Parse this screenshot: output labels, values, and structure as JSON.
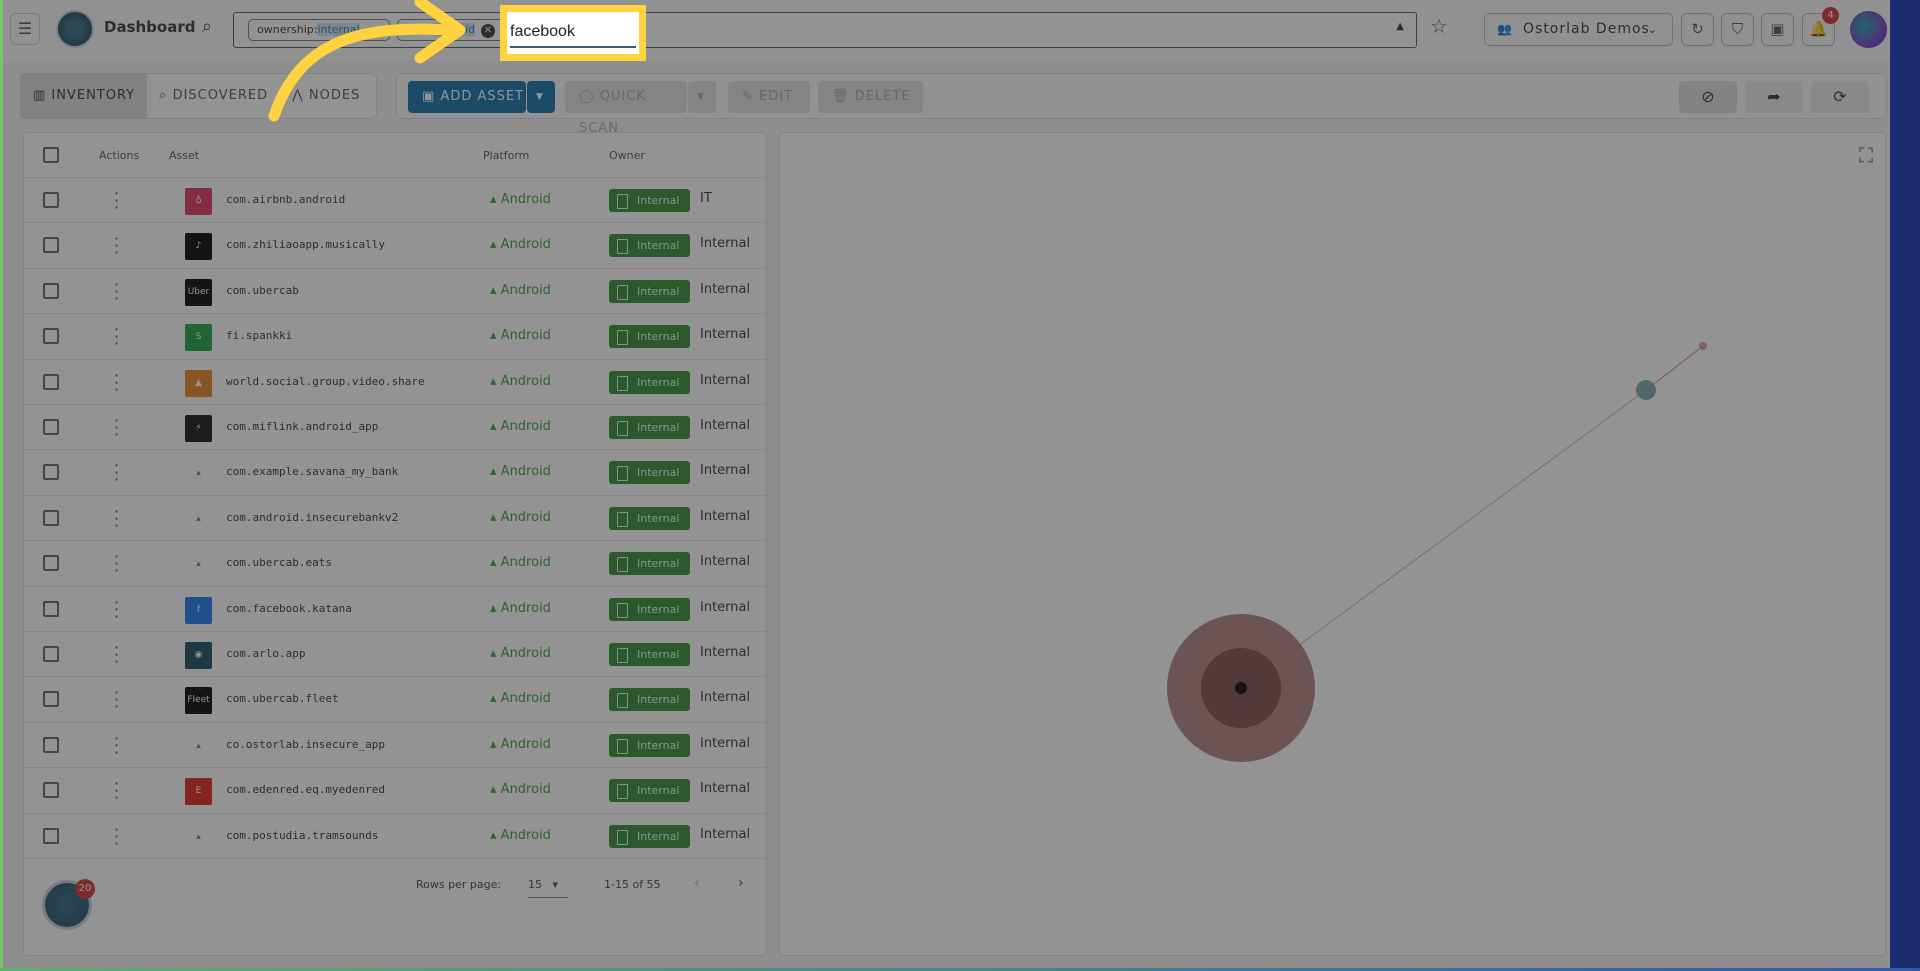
{
  "topbar": {
    "title": "Dashboard",
    "chips": [
      {
        "key": "ownership:",
        "value": "internal"
      },
      {
        "key": "",
        "value": "android"
      }
    ],
    "search_value": "facebook",
    "org": "Ostorlab Demos",
    "notifications": "4"
  },
  "tabs": [
    {
      "label": "INVENTORY",
      "active": true
    },
    {
      "label": "DISCOVERED"
    },
    {
      "label": "NODES"
    }
  ],
  "toolbar": {
    "add_asset": "ADD ASSET",
    "quick_scan": "QUICK SCAN",
    "edit": "EDIT",
    "delete": "DELETE"
  },
  "table": {
    "headers": {
      "actions": "Actions",
      "asset": "Asset",
      "platform": "Platform",
      "owner": "Owner"
    },
    "rows": [
      {
        "asset": "com.airbnb.android",
        "platform": "Android",
        "tag": "Internal",
        "owner": "IT",
        "color": "#e0305a",
        "icon": "airbnb-logo-icon",
        "glyph": "♁"
      },
      {
        "asset": "com.zhiliaoapp.musically",
        "platform": "Android",
        "tag": "Internal",
        "owner": "Internal",
        "color": "#000000",
        "icon": "tiktok-logo-icon",
        "glyph": "♪"
      },
      {
        "asset": "com.ubercab",
        "platform": "Android",
        "tag": "Internal",
        "owner": "Internal",
        "color": "#000000",
        "icon": "uber-logo-icon",
        "glyph": "Uber"
      },
      {
        "asset": "fi.spankki",
        "platform": "Android",
        "tag": "Internal",
        "owner": "Internal",
        "color": "#1ea040",
        "icon": "spankki-logo-icon",
        "glyph": "S"
      },
      {
        "asset": "world.social.group.video.share",
        "platform": "Android",
        "tag": "Internal",
        "owner": "Internal",
        "color": "#e8841c",
        "icon": "app-logo-icon",
        "glyph": "▲"
      },
      {
        "asset": "com.miflink.android_app",
        "platform": "Android",
        "tag": "Internal",
        "owner": "Internal",
        "color": "#111111",
        "icon": "miflink-logo-icon",
        "glyph": "⚡"
      },
      {
        "asset": "com.example.savana_my_bank",
        "platform": "Android",
        "tag": "Internal",
        "owner": "Internal",
        "color": "",
        "icon": "android-icon",
        "glyph": "▴"
      },
      {
        "asset": "com.android.insecurebankv2",
        "platform": "Android",
        "tag": "Internal",
        "owner": "Internal",
        "color": "",
        "icon": "android-icon",
        "glyph": "▴"
      },
      {
        "asset": "com.ubercab.eats",
        "platform": "Android",
        "tag": "Internal",
        "owner": "Internal",
        "color": "",
        "icon": "android-icon",
        "glyph": "▴"
      },
      {
        "asset": "com.facebook.katana",
        "platform": "Android",
        "tag": "Internal",
        "owner": "Internal",
        "color": "#1877f2",
        "icon": "facebook-logo-icon",
        "glyph": "f"
      },
      {
        "asset": "com.arlo.app",
        "platform": "Android",
        "tag": "Internal",
        "owner": "Internal",
        "color": "#124a5e",
        "icon": "arlo-logo-icon",
        "glyph": "◉"
      },
      {
        "asset": "com.ubercab.fleet",
        "platform": "Android",
        "tag": "Internal",
        "owner": "Internal",
        "color": "#000000",
        "icon": "uber-fleet-logo-icon",
        "glyph": "Fleet"
      },
      {
        "asset": "co.ostorlab.insecure_app",
        "platform": "Android",
        "tag": "Internal",
        "owner": "Internal",
        "color": "",
        "icon": "android-icon",
        "glyph": "▴"
      },
      {
        "asset": "com.edenred.eq.myedenred",
        "platform": "Android",
        "tag": "Internal",
        "owner": "Internal",
        "color": "#e2231a",
        "icon": "edenred-logo-icon",
        "glyph": "E"
      },
      {
        "asset": "com.postudia.tramsounds",
        "platform": "Android",
        "tag": "Internal",
        "owner": "Internal",
        "color": "",
        "icon": "android-icon",
        "glyph": "▴"
      }
    ]
  },
  "pagination": {
    "rows_per_page_label": "Rows per page:",
    "rows_per_page": "15",
    "range": "1-15 of 55"
  },
  "fab_badge": "20"
}
